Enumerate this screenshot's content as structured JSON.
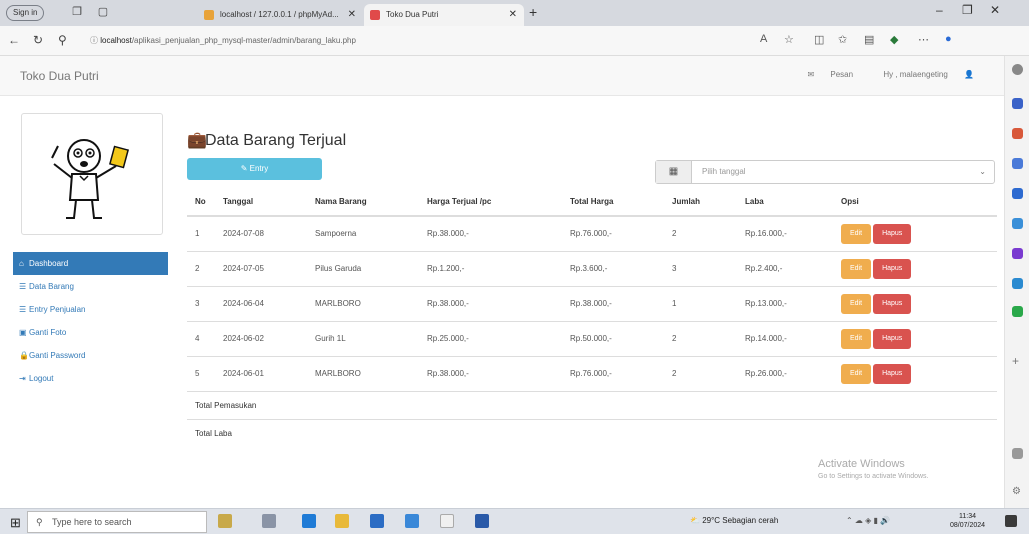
{
  "browser": {
    "signin_label": "Sign in",
    "tabs": [
      {
        "title": "localhost / 127.0.0.1 / phpMyAd..."
      },
      {
        "title": "Toko Dua Putri"
      }
    ],
    "url_host": "localhost",
    "url_path": "/aplikasi_penjualan_php_mysql-master/admin/barang_laku.php"
  },
  "navbar": {
    "brand": "Toko Dua Putri",
    "pesan_label": "Pesan",
    "user_greeting": "Hy , malaengeting"
  },
  "sidebar": {
    "items": [
      {
        "label": "Dashboard",
        "icon": "home-icon"
      },
      {
        "label": "Data Barang",
        "icon": "list-icon"
      },
      {
        "label": "Entry Penjualan",
        "icon": "list-icon"
      },
      {
        "label": "Ganti Foto",
        "icon": "picture-icon"
      },
      {
        "label": "Ganti Password",
        "icon": "lock-icon"
      },
      {
        "label": "Logout",
        "icon": "logout-icon"
      }
    ]
  },
  "main": {
    "title": "Data Barang Terjual",
    "entry_label": "Entry",
    "date_placeholder": "Pilih tanggal",
    "table": {
      "headers": [
        "No",
        "Tanggal",
        "Nama Barang",
        "Harga Terjual /pc",
        "Total Harga",
        "Jumlah",
        "Laba",
        "Opsi"
      ],
      "rows": [
        {
          "no": "1",
          "tanggal": "2024-07-08",
          "nama": "Sampoerna",
          "harga": "Rp.38.000,-",
          "total": "Rp.76.000,-",
          "jumlah": "2",
          "laba": "Rp.16.000,-"
        },
        {
          "no": "2",
          "tanggal": "2024-07-05",
          "nama": "Pilus Garuda",
          "harga": "Rp.1.200,-",
          "total": "Rp.3.600,-",
          "jumlah": "3",
          "laba": "Rp.2.400,-"
        },
        {
          "no": "3",
          "tanggal": "2024-06-04",
          "nama": "MARLBORO",
          "harga": "Rp.38.000,-",
          "total": "Rp.38.000,-",
          "jumlah": "1",
          "laba": "Rp.13.000,-"
        },
        {
          "no": "4",
          "tanggal": "2024-06-02",
          "nama": "Gurih 1L",
          "harga": "Rp.25.000,-",
          "total": "Rp.50.000,-",
          "jumlah": "2",
          "laba": "Rp.14.000,-"
        },
        {
          "no": "5",
          "tanggal": "2024-06-01",
          "nama": "MARLBORO",
          "harga": "Rp.38.000,-",
          "total": "Rp.76.000,-",
          "jumlah": "2",
          "laba": "Rp.26.000,-"
        }
      ],
      "edit_label": "Edit",
      "hapus_label": "Hapus",
      "total_pemasukan_label": "Total Pemasukan",
      "total_laba_label": "Total Laba"
    }
  },
  "watermark": {
    "line1": "Activate Windows",
    "line2": "Go to Settings to activate Windows."
  },
  "taskbar": {
    "search_placeholder": "Type here to search",
    "weather": "29°C  Sebagian cerah",
    "time": "11:34",
    "date": "08/07/2024"
  },
  "colors": {
    "primary": "#337ab7",
    "info": "#5bc0de",
    "warning": "#f0ad4e",
    "danger": "#d9534f"
  }
}
